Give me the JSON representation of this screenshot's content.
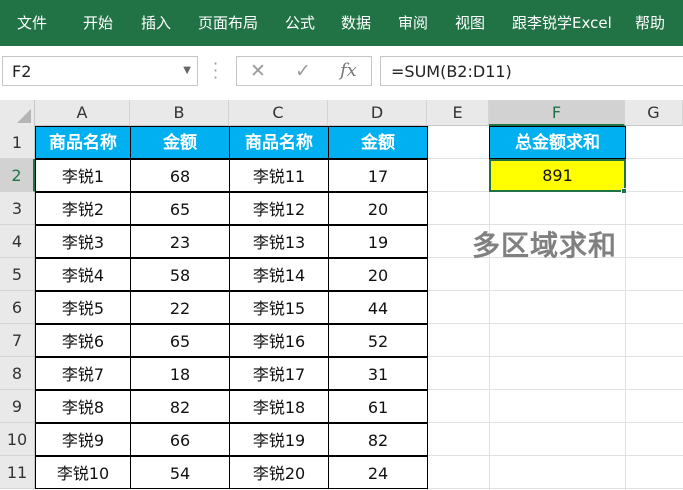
{
  "ribbon": {
    "tabs": [
      "文件",
      "开始",
      "插入",
      "页面布局",
      "公式",
      "数据",
      "审阅",
      "视图",
      "跟李锐学Excel",
      "帮助"
    ],
    "color": "#217346"
  },
  "formula_bar": {
    "name_box": "F2",
    "cancel_icon": "✕",
    "enter_icon": "✓",
    "function_icon": "fx",
    "formula": "=SUM(B2:D11)"
  },
  "columns": [
    "A",
    "B",
    "C",
    "D",
    "E",
    "F",
    "G"
  ],
  "rows": [
    "1",
    "2",
    "3",
    "4",
    "5",
    "6",
    "7",
    "8",
    "9",
    "10",
    "11"
  ],
  "table": {
    "headers": [
      "商品名称",
      "金额",
      "商品名称",
      "金额"
    ],
    "rows": [
      [
        "李锐1",
        "68",
        "李锐11",
        "17"
      ],
      [
        "李锐2",
        "65",
        "李锐12",
        "20"
      ],
      [
        "李锐3",
        "23",
        "李锐13",
        "19"
      ],
      [
        "李锐4",
        "58",
        "李锐14",
        "20"
      ],
      [
        "李锐5",
        "22",
        "李锐15",
        "44"
      ],
      [
        "李锐6",
        "65",
        "李锐16",
        "52"
      ],
      [
        "李锐7",
        "18",
        "李锐17",
        "31"
      ],
      [
        "李锐8",
        "82",
        "李锐18",
        "61"
      ],
      [
        "李锐9",
        "66",
        "李锐19",
        "82"
      ],
      [
        "李锐10",
        "54",
        "李锐20",
        "24"
      ]
    ],
    "header_color": "#00b0f0"
  },
  "summary": {
    "header": "总金额求和",
    "value": "891",
    "value_color": "#ffff00"
  },
  "overlay_title": "多区域求和"
}
